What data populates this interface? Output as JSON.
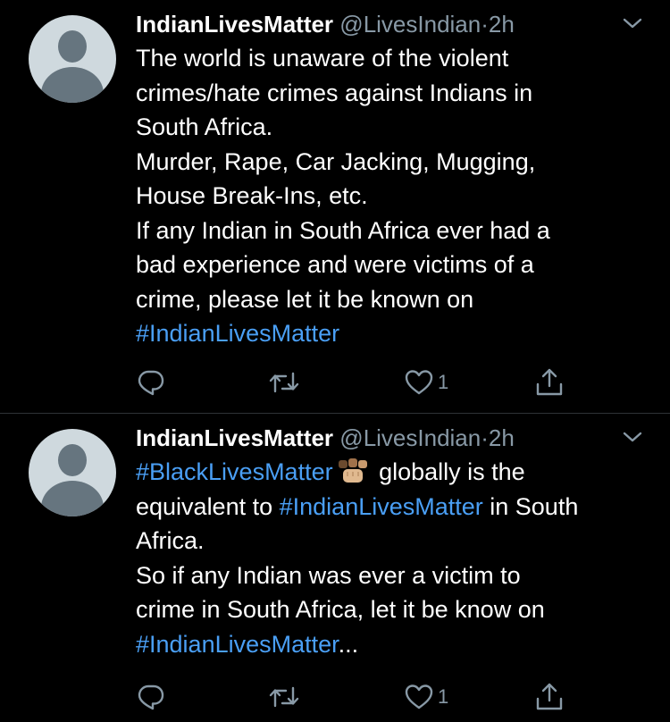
{
  "tweets": [
    {
      "author_name": "IndianLivesMatter",
      "handle": "@LivesIndian",
      "separator": "·",
      "time": "2h",
      "lines": [
        "The world is unaware of the violent",
        "crimes/hate crimes against Indians in",
        "South Africa.",
        "Murder, Rape, Car Jacking, Mugging,",
        "House Break-Ins, etc.",
        "If any Indian in South Africa ever had a",
        "bad experience and were victims of a",
        "crime, please let it be known on"
      ],
      "hashtag_line": "#IndianLivesMatter",
      "like_count": "1"
    },
    {
      "author_name": "IndianLivesMatter",
      "handle": "@LivesIndian",
      "separator": "·",
      "time": "2h",
      "line1_hashtag": "#BlackLivesMatter",
      "line1_rest": " globally is the",
      "line2_pre": "equivalent to ",
      "line2_hashtag": "#IndianLivesMatter",
      "line2_post": " in South",
      "line3": "Africa.",
      "line4": "So if any Indian was ever a victim to",
      "line5": "crime in South Africa, let it be know on",
      "line6_hashtag": "#IndianLivesMatter",
      "line6_ellipsis": "...",
      "like_count": "1"
    }
  ],
  "icons": {
    "reply": "reply-icon",
    "retweet": "retweet-icon",
    "like": "heart-icon",
    "share": "share-icon",
    "menu": "chevron-down-icon",
    "emoji": "raised-fists-emoji"
  },
  "colors": {
    "background": "#000000",
    "text": "#ffffff",
    "muted": "#8899a6",
    "link": "#4a9ff5",
    "divider": "#2f3336"
  }
}
